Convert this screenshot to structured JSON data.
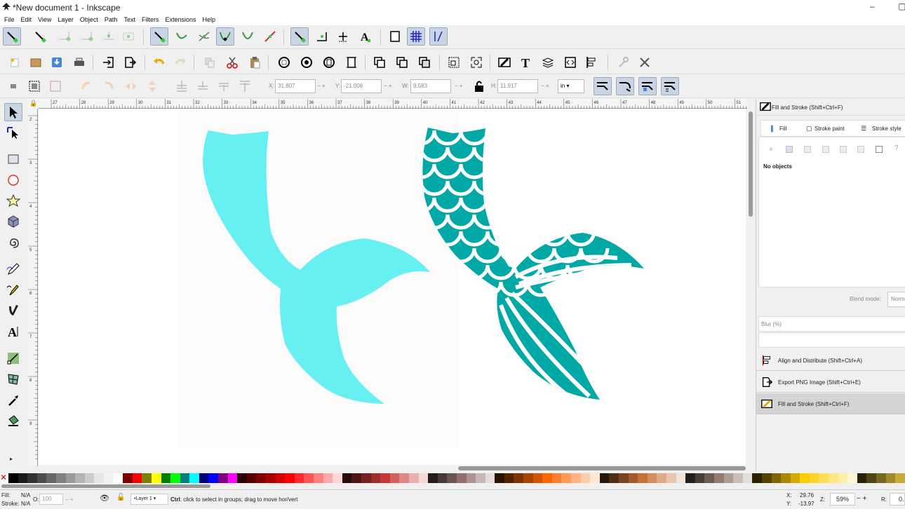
{
  "window": {
    "title": "*New document 1 - Inkscape",
    "minimize": "–",
    "maximize": "▢"
  },
  "menu": [
    "File",
    "Edit",
    "View",
    "Layer",
    "Object",
    "Path",
    "Text",
    "Filters",
    "Extensions",
    "Help"
  ],
  "toolbar3": {
    "x_label": "X:",
    "x_value": "31.807",
    "y_label": "Y:",
    "y_value": "-21.008",
    "w_label": "W:",
    "w_value": "9.583",
    "h_label": "H:",
    "h_value": "11.917",
    "unit": "in"
  },
  "ruler_h": [
    "27",
    "28",
    "29",
    "30",
    "31",
    "32",
    "33",
    "34",
    "35",
    "36",
    "37",
    "38",
    "39",
    "40",
    "41",
    "42",
    "43",
    "44",
    "45",
    "46",
    "47",
    "48",
    "49",
    "50",
    "51"
  ],
  "ruler_v": [
    "2",
    "3",
    "4",
    "5",
    "6",
    "7",
    "8",
    "9"
  ],
  "panel": {
    "header": "Fill and Stroke (Shift+Ctrl+F)",
    "tabs": [
      "Fill",
      "Stroke paint",
      "Stroke style"
    ],
    "paint_x": "×",
    "paint_q": "?",
    "no_objects": "No objects",
    "blend_label": "Blend mode:",
    "blend_value": "Norm",
    "blur_label": "Blur (%)",
    "docked": [
      "Align and Distribute (Shift+Ctrl+A)",
      "Export PNG Image (Shift+Ctrl+E)",
      "Fill and Stroke (Shift+Ctrl+F)"
    ]
  },
  "status": {
    "fill_label": "Fill:",
    "fill_value": "N/A",
    "stroke_label": "Stroke:",
    "stroke_value": "N/A",
    "o_label": "O:",
    "opacity": "100",
    "layer": "•Layer 1",
    "message_bold": "Ctrl",
    "message": ": click to select in groups; drag to move hor/vert",
    "x_label": "X:",
    "x": "29.76",
    "y_label": "Y:",
    "y": "-13.97",
    "z_label": "Z:",
    "zoom": "59%",
    "r_label": "R:",
    "r": "0."
  },
  "colors": {
    "tail_light": "#66f0f2",
    "tail_dark": "#00a9a5",
    "panel_active": "#d4d4d4"
  },
  "palette": [
    "#000000",
    "#1a1a1a",
    "#333333",
    "#4d4d4d",
    "#666666",
    "#808080",
    "#999999",
    "#b3b3b3",
    "#cccccc",
    "#e6e6e6",
    "#f2f2f2",
    "#ffffff",
    "#800000",
    "#ff0000",
    "#808000",
    "#ffff00",
    "#008000",
    "#00ff00",
    "#008080",
    "#00ffff",
    "#000080",
    "#0000ff",
    "#800080",
    "#ff00ff",
    "#2b0000",
    "#550000",
    "#800000",
    "#aa0000",
    "#d40000",
    "#ff0000",
    "#ff2a2a",
    "#ff5555",
    "#ff8080",
    "#ffaaaa",
    "#ffd5d5",
    "#280b0b",
    "#501616",
    "#782121",
    "#a02c2c",
    "#c83737",
    "#d35f5f",
    "#de8787",
    "#e9afaf",
    "#f4d7d7",
    "#241c1c",
    "#483737",
    "#6c5353",
    "#916f6f",
    "#ac9393",
    "#c8b7b7",
    "#e3dbdb",
    "#2b1100",
    "#552200",
    "#803300",
    "#aa4400",
    "#d45500",
    "#ff6600",
    "#ff7f2a",
    "#ff9955",
    "#ffb380",
    "#ffccaa",
    "#ffe6d5",
    "#28170b",
    "#502d16",
    "#784421",
    "#a05a2c",
    "#c87137",
    "#d38d5f",
    "#deaa87",
    "#e9c6af",
    "#f4e3d7",
    "#241f1c",
    "#483e37",
    "#6c5d53",
    "#917c6f",
    "#ac9d93",
    "#c8beb7",
    "#e3dedb",
    "#2b2200",
    "#554400",
    "#806600",
    "#aa8800",
    "#d4aa00",
    "#ffcc00",
    "#ffd42a",
    "#ffdd55",
    "#ffe680",
    "#ffeeaa",
    "#fff6d5",
    "#28220b",
    "#504416",
    "#786721",
    "#a0892c",
    "#c8ab37"
  ]
}
